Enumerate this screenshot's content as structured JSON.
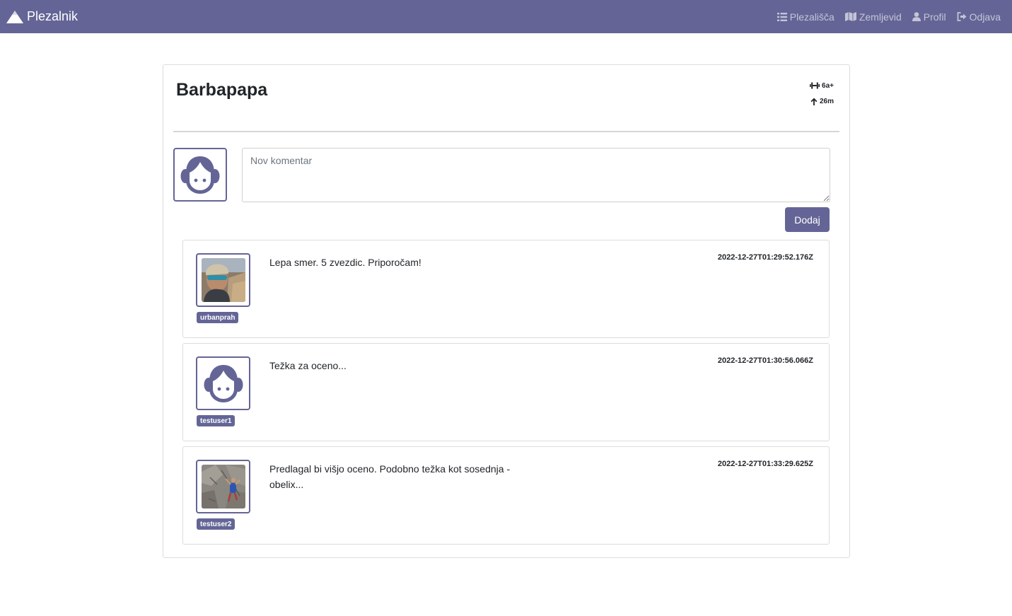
{
  "navbar": {
    "brand": "Plezalnik",
    "links": [
      {
        "label": "Plezališča",
        "icon": "list-icon"
      },
      {
        "label": "Zemljevid",
        "icon": "map-icon"
      },
      {
        "label": "Profil",
        "icon": "user-icon"
      },
      {
        "label": "Odjava",
        "icon": "sign-out-icon"
      }
    ],
    "background": "#646596"
  },
  "route": {
    "name": "Barbapapa",
    "grade": "6a+",
    "height": "26m"
  },
  "new_comment": {
    "placeholder": "Nov komentar",
    "value": "",
    "submit_label": "Dodaj"
  },
  "comments": [
    {
      "username": "urbanprah",
      "text": "Lepa smer. 5 zvezdic. Priporočam!",
      "timestamp": "2022-12-27T01:29:52.176Z",
      "avatar": "photo"
    },
    {
      "username": "testuser1",
      "text": "Težka za oceno...",
      "timestamp": "2022-12-27T01:30:56.066Z",
      "avatar": "default-avatar-icon"
    },
    {
      "username": "testuser2",
      "text": "Predlagal bi višjo oceno. Podobno težka kot sosednja - obelix...",
      "timestamp": "2022-12-27T01:33:29.625Z",
      "avatar": "photo"
    }
  ],
  "accent_color": "#646596"
}
